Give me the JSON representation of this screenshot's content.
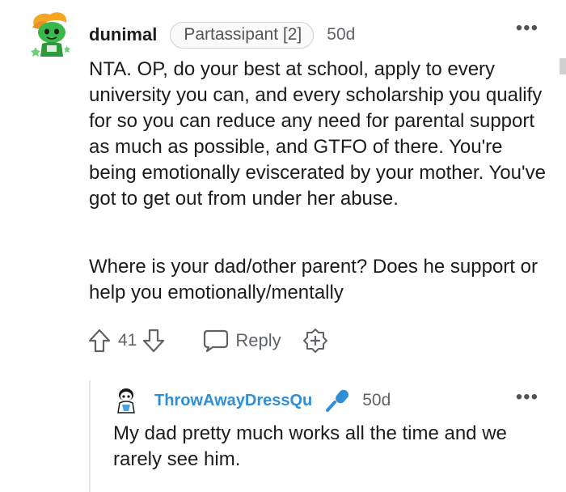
{
  "comment": {
    "username": "dunimal",
    "flair": "Partassipant [2]",
    "timestamp": "50d",
    "more_label": "•••",
    "paragraphs": [
      "NTA. OP, do your best at school, apply to every university you can, and every scholarship you qualify for so you can reduce any need for parental support as much as possible, and GTFO of there. You're being emotionally eviscerated by your mother. You've got to get out from under her abuse.",
      "Where is your dad/other parent? Does he support or help you emotionally/mentally"
    ],
    "vote_count": "41",
    "reply_label": "Reply"
  },
  "reply": {
    "username": "ThrowAwayDressQu",
    "timestamp": "50d",
    "more_label": "•••",
    "text": "My dad pretty much works all the time and we rarely see him.",
    "username_color": "#2f8fd6",
    "mic_color": "#2f8fd6"
  }
}
